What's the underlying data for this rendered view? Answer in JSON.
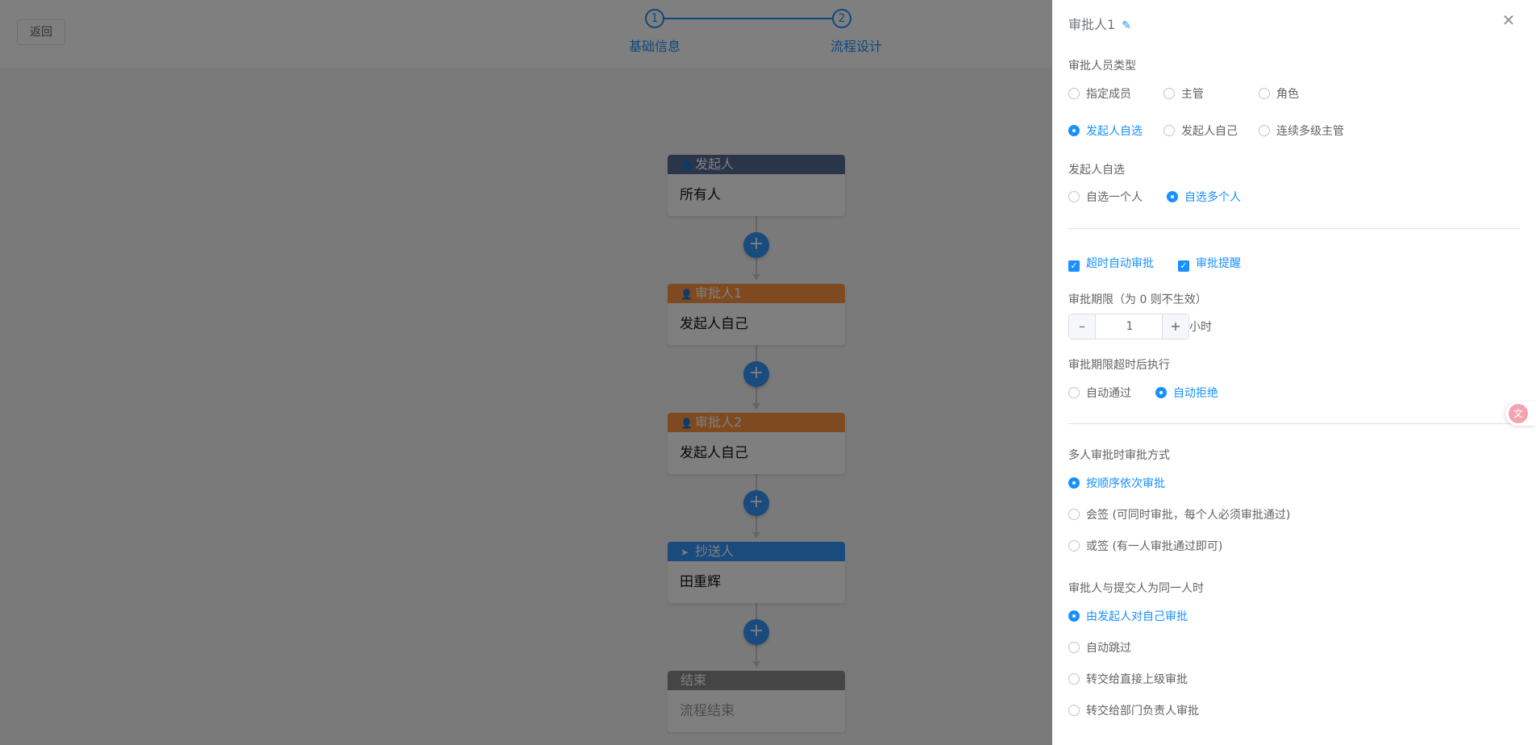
{
  "header": {
    "back_label": "返回",
    "steps": [
      {
        "number": "1",
        "label": "基础信息"
      },
      {
        "number": "2",
        "label": "流程设计"
      }
    ]
  },
  "flow": {
    "nodes": [
      {
        "title": "发起人",
        "content": "所有人",
        "color": "#576a95",
        "icon": "user-icon"
      },
      {
        "title": "审批人1",
        "content": "发起人自己",
        "color": "#ff943e",
        "icon": "user-icon"
      },
      {
        "title": "审批人2",
        "content": "发起人自己",
        "color": "#ff943e",
        "icon": "user-icon"
      },
      {
        "title": "抄送人",
        "content": "田重辉",
        "color": "#3296fa",
        "icon": "send-icon"
      },
      {
        "title": "结束",
        "content": "流程结束",
        "color": "#8a8a8a",
        "icon": ""
      }
    ],
    "add_symbol": "+"
  },
  "drawer": {
    "title": "审批人1",
    "approver_type": {
      "label": "审批人员类型",
      "options": [
        "指定成员",
        "主管",
        "角色",
        "发起人自选",
        "发起人自己",
        "连续多级主管"
      ],
      "selected": "发起人自选"
    },
    "self_select": {
      "label": "发起人自选",
      "options": [
        "自选一个人",
        "自选多个人"
      ],
      "selected": "自选多个人"
    },
    "checkboxes": [
      {
        "label": "超时自动审批",
        "checked": true
      },
      {
        "label": "审批提醒",
        "checked": true
      }
    ],
    "deadline": {
      "label": "审批期限（为 0 则不生效）",
      "value": "1",
      "unit": "小时"
    },
    "timeout_action": {
      "label": "审批期限超时后执行",
      "options": [
        "自动通过",
        "自动拒绝"
      ],
      "selected": "自动拒绝"
    },
    "multi_mode": {
      "label": "多人审批时审批方式",
      "options": [
        "按顺序依次审批",
        "会签 (可同时审批，每个人必须审批通过)",
        "或签 (有一人审批通过即可)"
      ],
      "selected": "按顺序依次审批"
    },
    "same_person": {
      "label": "审批人与提交人为同一人时",
      "options": [
        "由发起人对自己审批",
        "自动跳过",
        "转交给直接上级审批",
        "转交给部门负责人审批"
      ],
      "selected": "由发起人对自己审批"
    }
  },
  "colors": {
    "accent": "#1890ff",
    "overlay": "rgba(0,0,0,0.5)"
  }
}
